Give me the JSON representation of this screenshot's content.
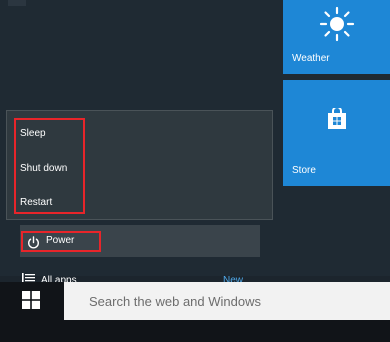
{
  "tiles": {
    "weather_label": "Weather",
    "store_label": "Store"
  },
  "power_menu": {
    "items": [
      "Sleep",
      "Shut down",
      "Restart"
    ]
  },
  "start_menu": {
    "power_label": "Power",
    "all_apps_label": "All apps",
    "new_badge": "New"
  },
  "taskbar": {
    "search_placeholder": "Search the web and Windows"
  },
  "colors": {
    "tile_blue": "#1e87d6",
    "highlight_red": "#e8252a",
    "accent_link": "#4fa8e8"
  },
  "icons": [
    "sun-icon",
    "store-bag-icon",
    "power-icon",
    "list-icon",
    "windows-logo-icon"
  ]
}
